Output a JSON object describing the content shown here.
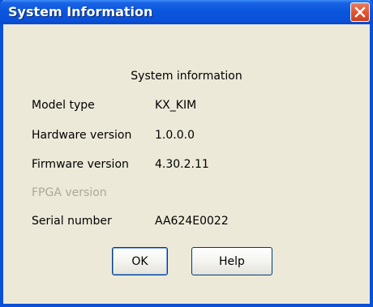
{
  "window": {
    "title": "System Information"
  },
  "content": {
    "heading": "System information",
    "rows": [
      {
        "label": "Model type",
        "value": "KX_KIM"
      },
      {
        "label": "Hardware version",
        "value": "1.0.0.0"
      },
      {
        "label": "Firmware version",
        "value": "4.30.2.11"
      },
      {
        "label": "FPGA version",
        "value": ""
      },
      {
        "label": "Serial number",
        "value": "AA624E0022"
      }
    ]
  },
  "buttons": {
    "ok_label": "OK",
    "help_label": "Help"
  },
  "icons": {
    "close": "close-icon"
  },
  "colors": {
    "titlebar": "#0a50d8",
    "window_bg": "#ece9d8",
    "close_button": "#e0532f",
    "disabled_text": "#aca899"
  }
}
